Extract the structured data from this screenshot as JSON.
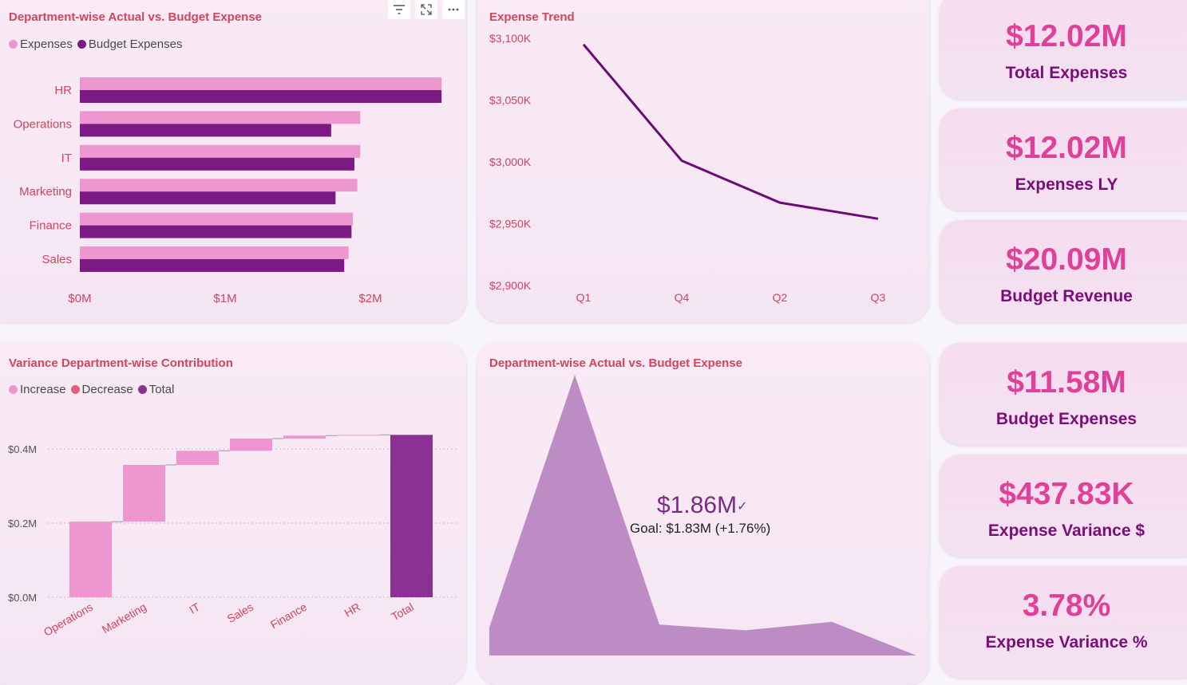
{
  "bar_panel": {
    "title": "Department-wise Actual vs. Budget Expense",
    "legend": [
      {
        "label": "Expenses",
        "color": "#ee96cf"
      },
      {
        "label": "Budget Expenses",
        "color": "#7b1a82"
      }
    ],
    "toolbar_icons": [
      "filter-icon",
      "focus-mode-icon",
      "more-options-icon"
    ]
  },
  "trend_panel": {
    "title": "Expense Trend"
  },
  "waterfall_panel": {
    "title": "Variance Department-wise Contribution",
    "legend": [
      {
        "label": "Increase",
        "color": "#ee96cf"
      },
      {
        "label": "Decrease",
        "color": "#e0607a"
      },
      {
        "label": "Total",
        "color": "#8a3193"
      }
    ]
  },
  "gauge_panel": {
    "title": "Department-wise Actual vs. Budget Expense",
    "kpi_value": "$1.86M",
    "kpi_goal": "Goal: $1.83M (+1.76%)"
  },
  "kpis": [
    {
      "value": "$12.02M",
      "label": "Total Expenses"
    },
    {
      "value": "$12.02M",
      "label": "Expenses LY"
    },
    {
      "value": "$20.09M",
      "label": "Budget Revenue"
    },
    {
      "value": "$11.58M",
      "label": "Budget Expenses"
    },
    {
      "value": "$437.83K",
      "label": "Expense Variance $"
    },
    {
      "value": "3.78%",
      "label": "Expense Variance %"
    }
  ],
  "chart_data": [
    {
      "type": "bar",
      "orientation": "horizontal",
      "title": "Department-wise Actual vs. Budget Expense",
      "categories": [
        "HR",
        "Operations",
        "IT",
        "Marketing",
        "Finance",
        "Sales"
      ],
      "series": [
        {
          "name": "Expenses",
          "values": [
            2.49,
            1.93,
            1.93,
            1.91,
            1.88,
            1.85
          ]
        },
        {
          "name": "Budget Expenses",
          "values": [
            2.49,
            1.73,
            1.89,
            1.76,
            1.87,
            1.82
          ]
        }
      ],
      "xlim": [
        0,
        2.6
      ],
      "ticks": [
        {
          "v": 0,
          "label": "$0M"
        },
        {
          "v": 1,
          "label": "$1M"
        },
        {
          "v": 2,
          "label": "$2M"
        }
      ],
      "legend": "top-left",
      "grid": false
    },
    {
      "type": "line",
      "title": "Expense Trend",
      "categories": [
        "Q1",
        "Q4",
        "Q2",
        "Q3"
      ],
      "values": [
        3095,
        3001,
        2967,
        2954
      ],
      "ylim": [
        2900,
        3100
      ],
      "yticks": [
        {
          "v": 3100,
          "label": "$3,100K"
        },
        {
          "v": 3050,
          "label": "$3,050K"
        },
        {
          "v": 3000,
          "label": "$3,000K"
        },
        {
          "v": 2950,
          "label": "$2,950K"
        },
        {
          "v": 2900,
          "label": "$2,900K"
        }
      ],
      "color": "#6c0a78",
      "grid": false
    },
    {
      "type": "bar",
      "subtype": "waterfall",
      "title": "Variance Department-wise Contribution",
      "categories": [
        "Operations",
        "Marketing",
        "IT",
        "Sales",
        "Finance",
        "HR",
        "Total"
      ],
      "values": [
        0.204,
        0.153,
        0.038,
        0.033,
        0.008,
        0.002,
        0.438
      ],
      "kinds": [
        "increase",
        "increase",
        "increase",
        "increase",
        "increase",
        "increase",
        "total"
      ],
      "ylim": [
        0,
        0.45
      ],
      "yticks": [
        {
          "v": 0,
          "label": "$0.0M"
        },
        {
          "v": 0.2,
          "label": "$0.2M"
        },
        {
          "v": 0.4,
          "label": "$0.4M"
        }
      ],
      "legend": "top-left",
      "grid": true
    },
    {
      "type": "area",
      "title": "Department-wise Actual vs. Budget Expense",
      "values": [
        0.1,
        1.0,
        0.11,
        0.09,
        0.12,
        0.0
      ],
      "color": "#bd8cc4"
    }
  ]
}
